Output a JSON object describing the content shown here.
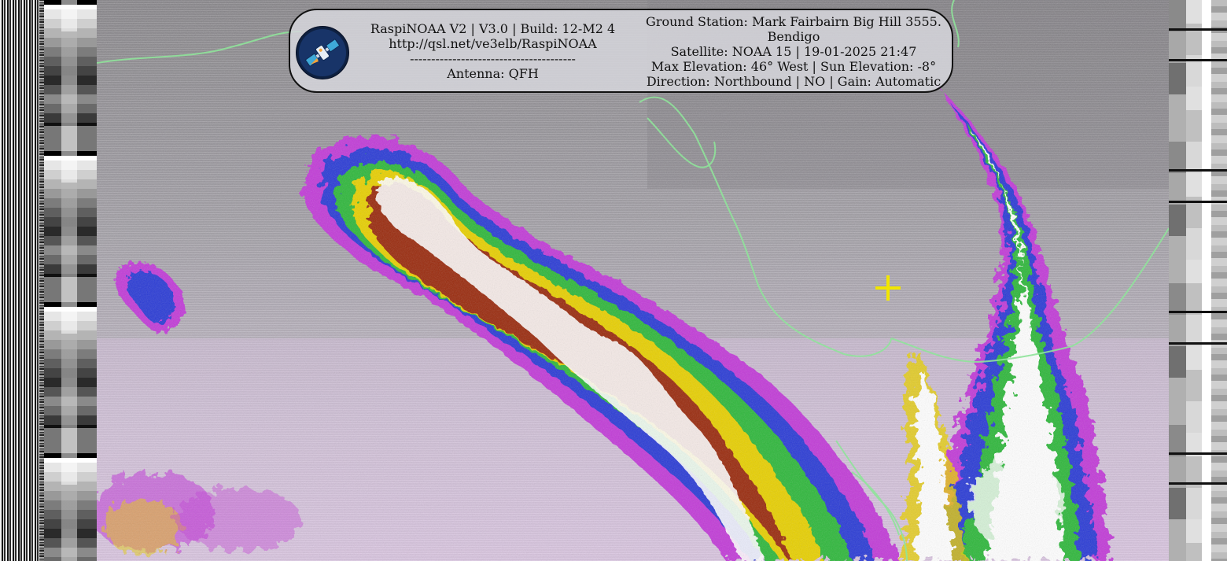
{
  "banner": {
    "app_line": "RaspiNOAA V2 | V3.0 | Build: 12-M2 4",
    "url": "http://qsl.net/ve3elb/RaspiNOAA",
    "separator": "---------------------------------------",
    "antenna": "Antenna: QFH",
    "ground_station_line1": "Ground Station: Mark Fairbairn Big Hill 3555.",
    "ground_station_line2": "Bendigo",
    "satellite": "Satellite: NOAA 15 | 19-01-2025 21:47",
    "elevation": "Max Elevation: 46° West | Sun Elevation: -8°",
    "direction": "Direction: Northbound | NO | Gain: Automatic"
  },
  "logo": {
    "icon": "satellite-icon"
  },
  "marker": {
    "icon": "crosshair-plus-icon",
    "color": "#f2e600"
  },
  "colors": {
    "coastline": "#8fe39a",
    "cloud_white": "#ffffff",
    "cloud_red": "#9a2a10",
    "cloud_yellow": "#e8d000",
    "cloud_green": "#2fb83a",
    "cloud_blue": "#2b3bd6",
    "cloud_magenta": "#c23ad8"
  }
}
